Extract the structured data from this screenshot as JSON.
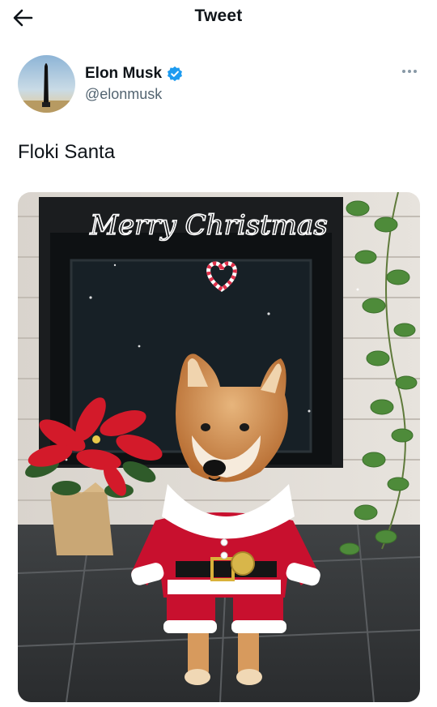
{
  "header": {
    "title": "Tweet",
    "back_icon": "arrow-left-icon"
  },
  "author": {
    "display_name": "Elon Musk",
    "handle": "@elonmusk",
    "verified": true,
    "verified_color": "#1d9bf0",
    "avatar_icon": "starship-rocket-avatar",
    "more_icon": "ellipsis-horizontal-icon"
  },
  "tweet": {
    "text": "Floki Santa"
  },
  "media": {
    "overlay_text": "Merry Christmas",
    "heart_icon": "candy-cane-heart-icon"
  },
  "colors": {
    "text_primary": "#0f1419",
    "text_secondary": "#536471",
    "accent": "#1d9bf0"
  }
}
